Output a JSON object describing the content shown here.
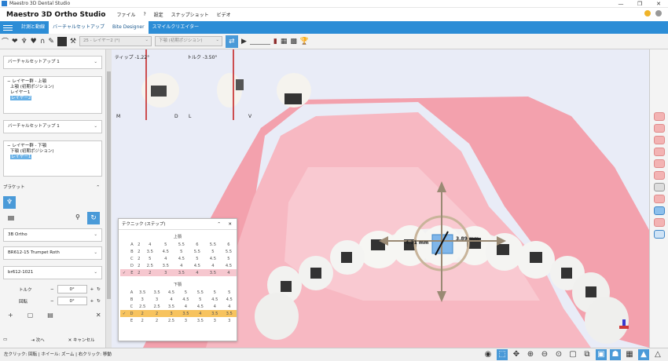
{
  "window": {
    "title": "Maestro 3D Dental Studio",
    "min": "—",
    "max": "❐",
    "close": "✕"
  },
  "menu": {
    "brand": "Maestro 3D Ortho Studio",
    "items": [
      "ファイル",
      "?",
      "設定",
      "スナップショット",
      "ビデオ"
    ]
  },
  "tabs": [
    "計測と動線",
    "バーチャルセットアップ",
    "Bite Designer",
    "スマイルクリエイター"
  ],
  "toolbar": {
    "layer_select": "25 - レイヤー2 (*)",
    "arch_select": "下顎 (初期ポジション)"
  },
  "viewport": {
    "tip_label": "ティップ -1.22°",
    "torque_label": "トルク -3.50°",
    "view_letters": [
      "M",
      "D",
      "L",
      "V"
    ],
    "dim_left": "4.21 mm",
    "dim_right": "3.89 mm"
  },
  "sidebar": {
    "setup1": "バーチャルセットアップ 1",
    "tree_upper": {
      "group": "レイヤー群 - 上顎",
      "item1": "上顎 (初期ポジション)",
      "item2": "レイヤー1",
      "item3": "レイヤー2"
    },
    "setup2": "バーチャルセットアップ 1",
    "tree_lower": {
      "group": "レイヤー群 - 下顎",
      "item1": "下顎 (初期ポジション)",
      "item2": "レイヤー1"
    },
    "bracket_header": "ブラケット",
    "brand": "3B Ortho",
    "model": "BR612-15 Trumpet Roth",
    "code": "br612-1021",
    "torque_label": "トルク",
    "torque_value": "0°",
    "rotation_label": "回転",
    "rotation_value": "0°",
    "next": "次へ",
    "cancel": "キャンセル"
  },
  "technique": {
    "title": "テクニック (ステップ)",
    "upper_label": "上顎",
    "lower_label": "下顎",
    "upper_rows": [
      [
        "A",
        "2",
        "4",
        "5",
        "5.5",
        "6",
        "5.5",
        "6"
      ],
      [
        "B",
        "2",
        "3.5",
        "4.5",
        "5",
        "5.5",
        "5",
        "5.5"
      ],
      [
        "C",
        "2",
        "5",
        "4",
        "4.5",
        "5",
        "4.5",
        "5"
      ],
      [
        "D",
        "2",
        "2.5",
        "3.5",
        "4",
        "4.5",
        "4",
        "4.5"
      ],
      [
        "E",
        "2",
        "2",
        "3",
        "3.5",
        "4",
        "3.5",
        "4"
      ]
    ],
    "lower_rows": [
      [
        "A",
        "3.5",
        "3.5",
        "4.5",
        "5",
        "5.5",
        "5",
        "5"
      ],
      [
        "B",
        "3",
        "3",
        "4",
        "4.5",
        "5",
        "4.5",
        "4.5"
      ],
      [
        "C",
        "2.5",
        "2.5",
        "3.5",
        "4",
        "4.5",
        "4",
        "4"
      ],
      [
        "D",
        "2",
        "2",
        "3",
        "3.5",
        "4",
        "3.5",
        "3.5"
      ],
      [
        "E",
        "2",
        "2",
        "2.5",
        "3",
        "3.5",
        "3",
        "3"
      ]
    ]
  },
  "status": {
    "hint": "左クリック: 回転 | ホイール: ズーム | 右クリック: 移動"
  }
}
